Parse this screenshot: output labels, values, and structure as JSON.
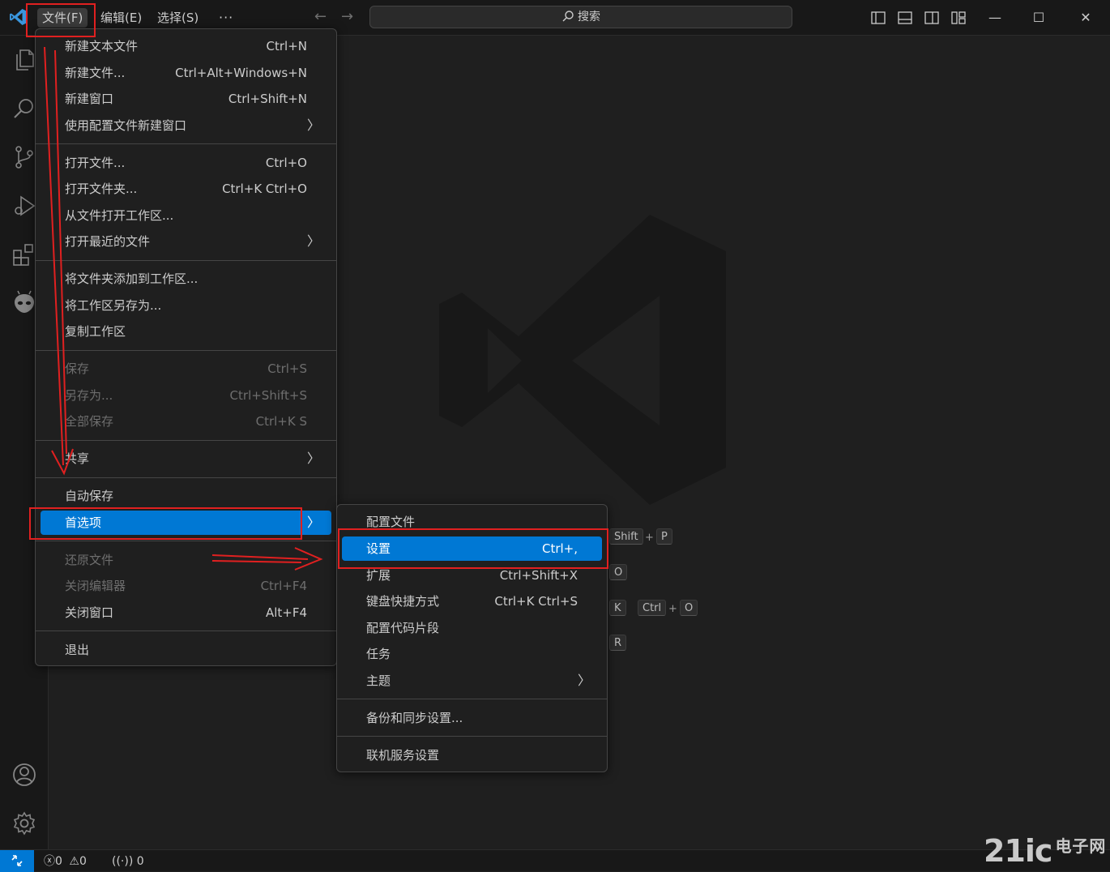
{
  "titlebar": {
    "menus": {
      "file": "文件(F)",
      "edit": "编辑(E)",
      "select": "选择(S)",
      "more": "···"
    },
    "search_label": "搜索"
  },
  "file_menu": {
    "items": [
      {
        "label": "新建文本文件",
        "shortcut": "Ctrl+N"
      },
      {
        "label": "新建文件...",
        "shortcut": "Ctrl+Alt+Windows+N"
      },
      {
        "label": "新建窗口",
        "shortcut": "Ctrl+Shift+N"
      },
      {
        "label": "使用配置文件新建窗口",
        "shortcut": ""
      },
      {
        "label": "打开文件...",
        "shortcut": "Ctrl+O"
      },
      {
        "label": "打开文件夹...",
        "shortcut": "Ctrl+K Ctrl+O"
      },
      {
        "label": "从文件打开工作区...",
        "shortcut": ""
      },
      {
        "label": "打开最近的文件",
        "shortcut": ""
      },
      {
        "label": "将文件夹添加到工作区...",
        "shortcut": ""
      },
      {
        "label": "将工作区另存为...",
        "shortcut": ""
      },
      {
        "label": "复制工作区",
        "shortcut": ""
      },
      {
        "label": "保存",
        "shortcut": "Ctrl+S"
      },
      {
        "label": "另存为...",
        "shortcut": "Ctrl+Shift+S"
      },
      {
        "label": "全部保存",
        "shortcut": "Ctrl+K S"
      },
      {
        "label": "共享",
        "shortcut": ""
      },
      {
        "label": "自动保存",
        "shortcut": ""
      },
      {
        "label": "首选项",
        "shortcut": ""
      },
      {
        "label": "还原文件",
        "shortcut": ""
      },
      {
        "label": "关闭编辑器",
        "shortcut": "Ctrl+F4"
      },
      {
        "label": "关闭窗口",
        "shortcut": "Alt+F4"
      },
      {
        "label": "退出",
        "shortcut": ""
      }
    ]
  },
  "preferences_menu": {
    "items": [
      {
        "label": "配置文件",
        "shortcut": ""
      },
      {
        "label": "设置",
        "shortcut": "Ctrl+,"
      },
      {
        "label": "扩展",
        "shortcut": "Ctrl+Shift+X"
      },
      {
        "label": "键盘快捷方式",
        "shortcut": "Ctrl+K Ctrl+S"
      },
      {
        "label": "配置代码片段",
        "shortcut": ""
      },
      {
        "label": "任务",
        "shortcut": ""
      },
      {
        "label": "主题",
        "shortcut": ""
      },
      {
        "label": "备份和同步设置...",
        "shortcut": ""
      },
      {
        "label": "联机服务设置",
        "shortcut": ""
      }
    ]
  },
  "welcome_keys": {
    "row1": [
      "Shift",
      "P"
    ],
    "row2": [
      "O"
    ],
    "row3": [
      "K",
      "Ctrl",
      "O"
    ],
    "row4": [
      "R"
    ],
    "plus": "+"
  },
  "statusbar": {
    "errors": "0",
    "warnings": "0",
    "ports": "0"
  },
  "watermark": {
    "brand": "21ic",
    "cn": "电子网"
  },
  "colors": {
    "accent": "#0078d4",
    "annotation": "#e02020"
  }
}
